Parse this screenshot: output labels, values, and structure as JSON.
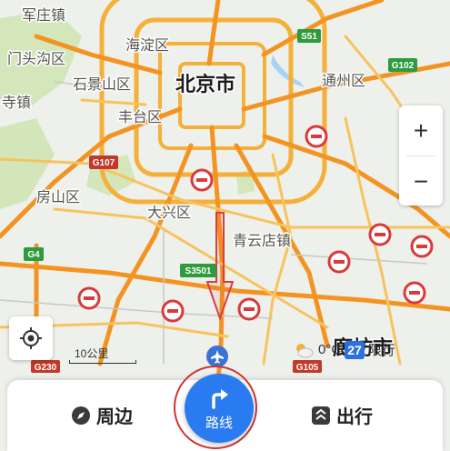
{
  "map": {
    "city_label": "北京市",
    "districts": {
      "junzhuang": "军庄镇",
      "haidian": "海淀区",
      "mentougou": "门头沟区",
      "shijingshan": "石景山区",
      "tongzhou": "通州区",
      "zhaisi": "寺镇",
      "fengtai": "丰台区",
      "fangshan": "房山区",
      "daxing": "大兴区",
      "qingyundian": "青云店镇",
      "langfang": "廊坊市"
    },
    "roads": {
      "s51": "S51",
      "g102": "G102",
      "g107": "G107",
      "g4": "G4",
      "s3501": "S3501",
      "g230": "G230",
      "g105": "G105"
    },
    "colors": {
      "major_road": "#f5b03a",
      "expressway": "#f39422",
      "park": "#cfe6b5",
      "water": "#a9d3f2",
      "route_outline": "#d64040",
      "accent": "#2a7af0"
    }
  },
  "controls": {
    "zoom_in": "+",
    "zoom_out": "−",
    "locate_icon": "crosshair-icon",
    "scale": "10公里"
  },
  "weather": {
    "temp": "0°C",
    "aqi": "27",
    "restriction": "限行"
  },
  "bottom_bar": {
    "nearby": "周边",
    "route": "路线",
    "travel": "出行"
  }
}
